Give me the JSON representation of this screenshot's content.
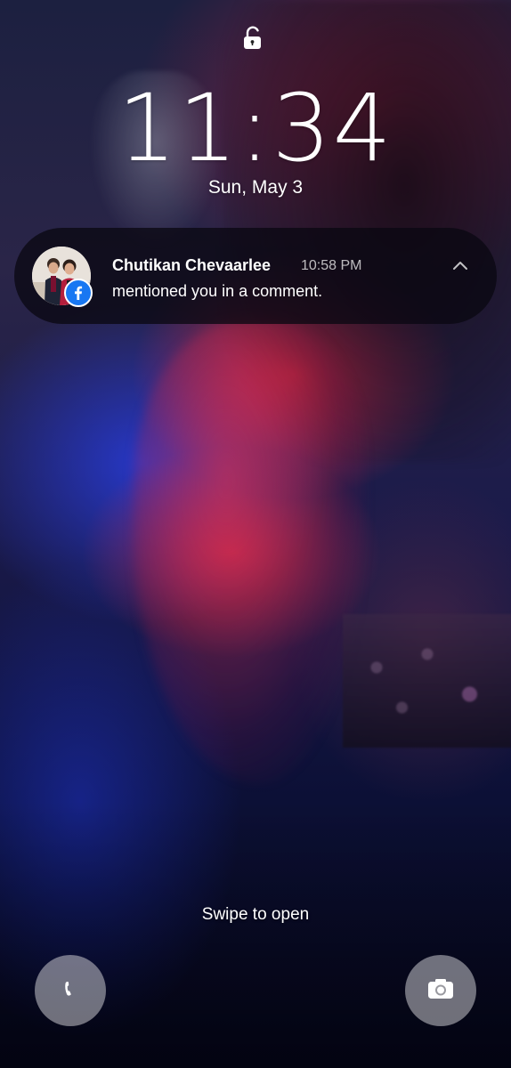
{
  "lockscreen": {
    "lock_icon": "unlocked-padlock-icon",
    "time": "11:34",
    "date": "Sun, May 3"
  },
  "notification": {
    "app_icon": "facebook-icon",
    "avatar_icon": "contact-photo",
    "sender": "Chutikan Chevaarlee",
    "time": "10:58 PM",
    "message": "mentioned you in a comment.",
    "collapse_icon": "chevron-up-icon",
    "accent_color": "#1877f2"
  },
  "bottom": {
    "swipe_hint": "Swipe to open",
    "left_shortcut_icon": "phone-icon",
    "right_shortcut_icon": "camera-icon"
  }
}
